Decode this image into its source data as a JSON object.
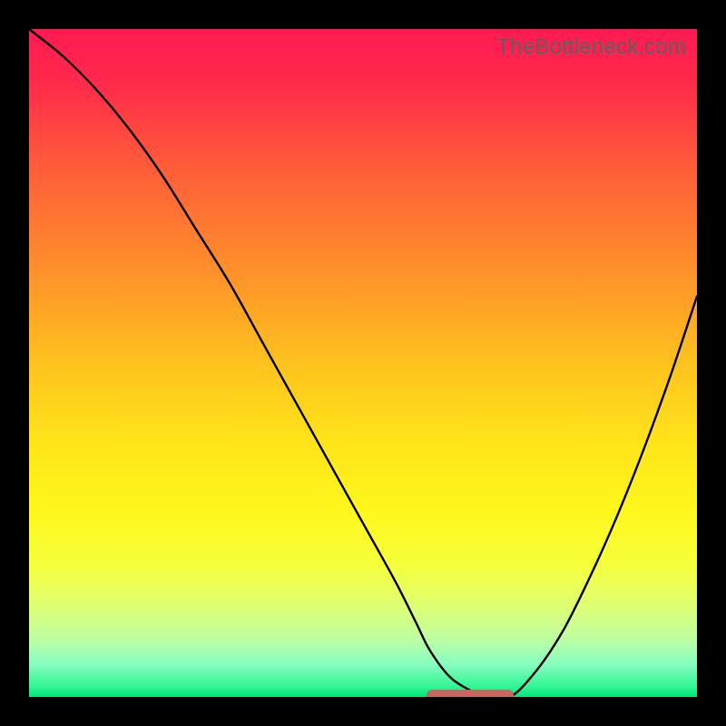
{
  "watermark": "TheBottleneck.com",
  "colors": {
    "frame": "#000000",
    "watermark": "#5f5f5f",
    "curve": "#000000",
    "flat_marker": "#c86660",
    "gradient_stops": [
      {
        "offset": 0.0,
        "color": "#ff1a52"
      },
      {
        "offset": 0.08,
        "color": "#ff2a4b"
      },
      {
        "offset": 0.2,
        "color": "#ff5a3a"
      },
      {
        "offset": 0.35,
        "color": "#ff8c2c"
      },
      {
        "offset": 0.5,
        "color": "#ffc21e"
      },
      {
        "offset": 0.62,
        "color": "#ffe41a"
      },
      {
        "offset": 0.72,
        "color": "#fff71c"
      },
      {
        "offset": 0.8,
        "color": "#f6ff3a"
      },
      {
        "offset": 0.86,
        "color": "#e0ff70"
      },
      {
        "offset": 0.91,
        "color": "#c0ffa0"
      },
      {
        "offset": 0.95,
        "color": "#88ffc0"
      },
      {
        "offset": 0.985,
        "color": "#30f593"
      },
      {
        "offset": 1.0,
        "color": "#00e57a"
      }
    ]
  },
  "chart_data": {
    "type": "line",
    "title": "",
    "xlabel": "",
    "ylabel": "",
    "xlim": [
      0,
      100
    ],
    "ylim": [
      0,
      100
    ],
    "series": [
      {
        "name": "bottleneck-curve",
        "x": [
          0,
          5,
          10,
          15,
          20,
          25,
          30,
          35,
          40,
          45,
          50,
          55,
          58,
          60,
          63,
          66,
          68,
          72,
          76,
          80,
          84,
          88,
          92,
          96,
          100
        ],
        "y": [
          100,
          96,
          91,
          85,
          78,
          70,
          62,
          53,
          44,
          35,
          26,
          17,
          11,
          7,
          3,
          1,
          0,
          0,
          4,
          10,
          18,
          27,
          37,
          48,
          60
        ]
      }
    ],
    "annotations": [
      {
        "name": "flat-minimum-marker",
        "x_start": 60,
        "x_end": 72,
        "y": 0
      }
    ],
    "grid": false,
    "legend": false
  }
}
